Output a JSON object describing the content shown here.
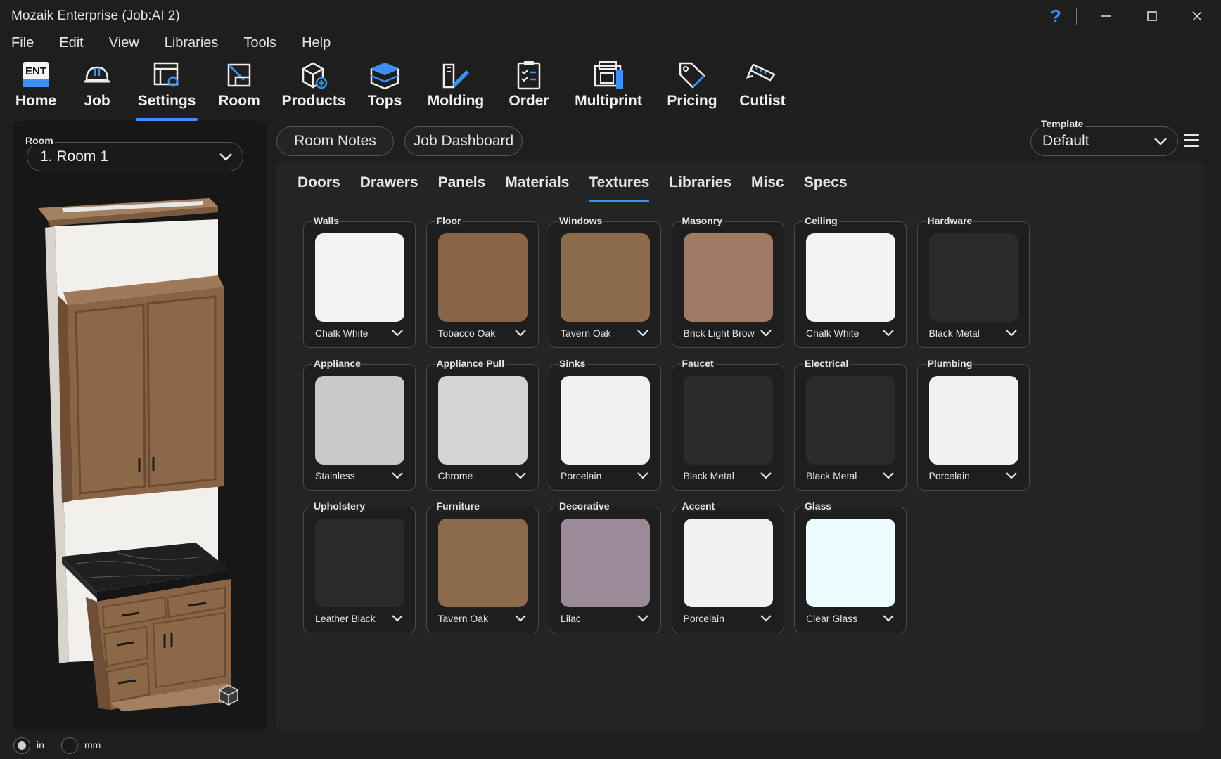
{
  "window": {
    "title": "Mozaik Enterprise (Job:AI 2)",
    "help": "?"
  },
  "menu": [
    "File",
    "Edit",
    "View",
    "Libraries",
    "Tools",
    "Help"
  ],
  "ribbon": [
    {
      "label": "Home",
      "icon": "ent-home-icon"
    },
    {
      "label": "Job",
      "icon": "hardhat-icon"
    },
    {
      "label": "Settings",
      "icon": "settings-icon",
      "active": true
    },
    {
      "label": "Room",
      "icon": "room-icon"
    },
    {
      "label": "Products",
      "icon": "products-icon"
    },
    {
      "label": "Tops",
      "icon": "tops-icon"
    },
    {
      "label": "Molding",
      "icon": "molding-icon"
    },
    {
      "label": "Order",
      "icon": "order-icon"
    },
    {
      "label": "Multiprint",
      "icon": "multiprint-icon"
    },
    {
      "label": "Pricing",
      "icon": "pricing-tag-icon"
    },
    {
      "label": "Cutlist",
      "icon": "cutlist-saw-icon"
    }
  ],
  "ent_logo": "ENT",
  "room": {
    "label": "Room",
    "value": "1. Room 1"
  },
  "buttons": {
    "room_notes": "Room Notes",
    "job_dashboard": "Job Dashboard"
  },
  "template": {
    "label": "Template",
    "value": "Default"
  },
  "tabs": [
    "Doors",
    "Drawers",
    "Panels",
    "Materials",
    "Textures",
    "Libraries",
    "Misc",
    "Specs"
  ],
  "active_tab": "Textures",
  "textures": [
    {
      "label": "Walls",
      "value": "Chalk White",
      "color": "#f3f3f3"
    },
    {
      "label": "Floor",
      "value": "Tobacco Oak",
      "color": "#8a6446"
    },
    {
      "label": "Windows",
      "value": "Tavern Oak",
      "color": "#8c6a4c"
    },
    {
      "label": "Masonry",
      "value": "Brick Light Brow",
      "color": "#9e7a62"
    },
    {
      "label": "Ceiling",
      "value": "Chalk White",
      "color": "#f3f3f3"
    },
    {
      "label": "Hardware",
      "value": "Black Metal",
      "color": "#2b2b2b"
    },
    {
      "label": "Appliance",
      "value": "Stainless",
      "color": "#c9c9c9"
    },
    {
      "label": "Appliance Pull",
      "value": "Chrome",
      "color": "#d4d4d4"
    },
    {
      "label": "Sinks",
      "value": "Porcelain",
      "color": "#f1f1f1"
    },
    {
      "label": "Faucet",
      "value": "Black Metal",
      "color": "#2b2b2b"
    },
    {
      "label": "Electrical",
      "value": "Black Metal",
      "color": "#2b2b2b"
    },
    {
      "label": "Plumbing",
      "value": "Porcelain",
      "color": "#f1f1f1"
    },
    {
      "label": "Upholstery",
      "value": "Leather Black",
      "color": "#2a2a2c"
    },
    {
      "label": "Furniture",
      "value": "Tavern Oak",
      "color": "#8c6a4c"
    },
    {
      "label": "Decorative",
      "value": "Lilac",
      "color": "#9b8a97"
    },
    {
      "label": "Accent",
      "value": "Porcelain",
      "color": "#f1f1f1"
    },
    {
      "label": "Glass",
      "value": "Clear Glass",
      "color": "#ecfcff"
    }
  ],
  "units": {
    "in": "in",
    "mm": "mm",
    "selected": "in"
  },
  "colors": {
    "accent": "#3b8ff5",
    "bg": "#1e1e1e",
    "panel": "#242424"
  }
}
